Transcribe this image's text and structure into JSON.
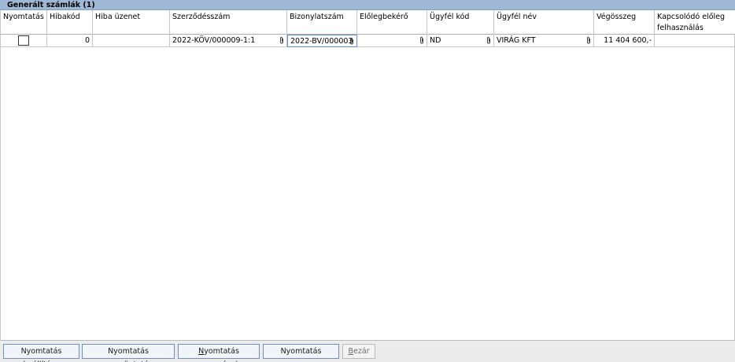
{
  "window": {
    "title": "Generált számlák (1)"
  },
  "table": {
    "columns": [
      {
        "key": "nyomtatas",
        "label": "Nyomtatás"
      },
      {
        "key": "hibakod",
        "label": "Hibakód"
      },
      {
        "key": "hiba_uzenet",
        "label": "Hiba üzenet"
      },
      {
        "key": "szerzodesszam",
        "label": "Szerződésszám"
      },
      {
        "key": "bizonylatszam",
        "label": "Bizonylatszám"
      },
      {
        "key": "elolegbekero",
        "label": "Előlegbekérő"
      },
      {
        "key": "ugyfel_kod",
        "label": "Ügyfél kód"
      },
      {
        "key": "ugyfel_nev",
        "label": "Ügyfél név"
      },
      {
        "key": "vegosszeg",
        "label": "Végösszeg"
      },
      {
        "key": "kapcsolodo",
        "label": "Kapcsolódó előleg felhasználás"
      }
    ],
    "rows": [
      {
        "nyomtatas": false,
        "hibakod": "0",
        "hiba_uzenet": "",
        "szerzodesszam": "2022-KÖV/000009-1:1",
        "bizonylatszam": "2022-BV/000003",
        "elolegbekero": "",
        "ugyfel_kod": "ND",
        "ugyfel_nev": "VIRÁG KFT",
        "vegosszeg": "11 404 600,-",
        "kapcsolodo": ""
      }
    ]
  },
  "footer": {
    "btn_settings": "Nyomtatás beállítása",
    "btn_cancel_print": "Nyomtatás megszüntetése",
    "btn_print_each_rest": "yomtatás egyesével",
    "btn_print_each_mn": "N",
    "btn_print_once": "Nyomtatás egyszerre",
    "btn_close_mn": "B",
    "btn_close_rest": "ezár"
  },
  "icons": {
    "attach": "paperclip-icon"
  }
}
